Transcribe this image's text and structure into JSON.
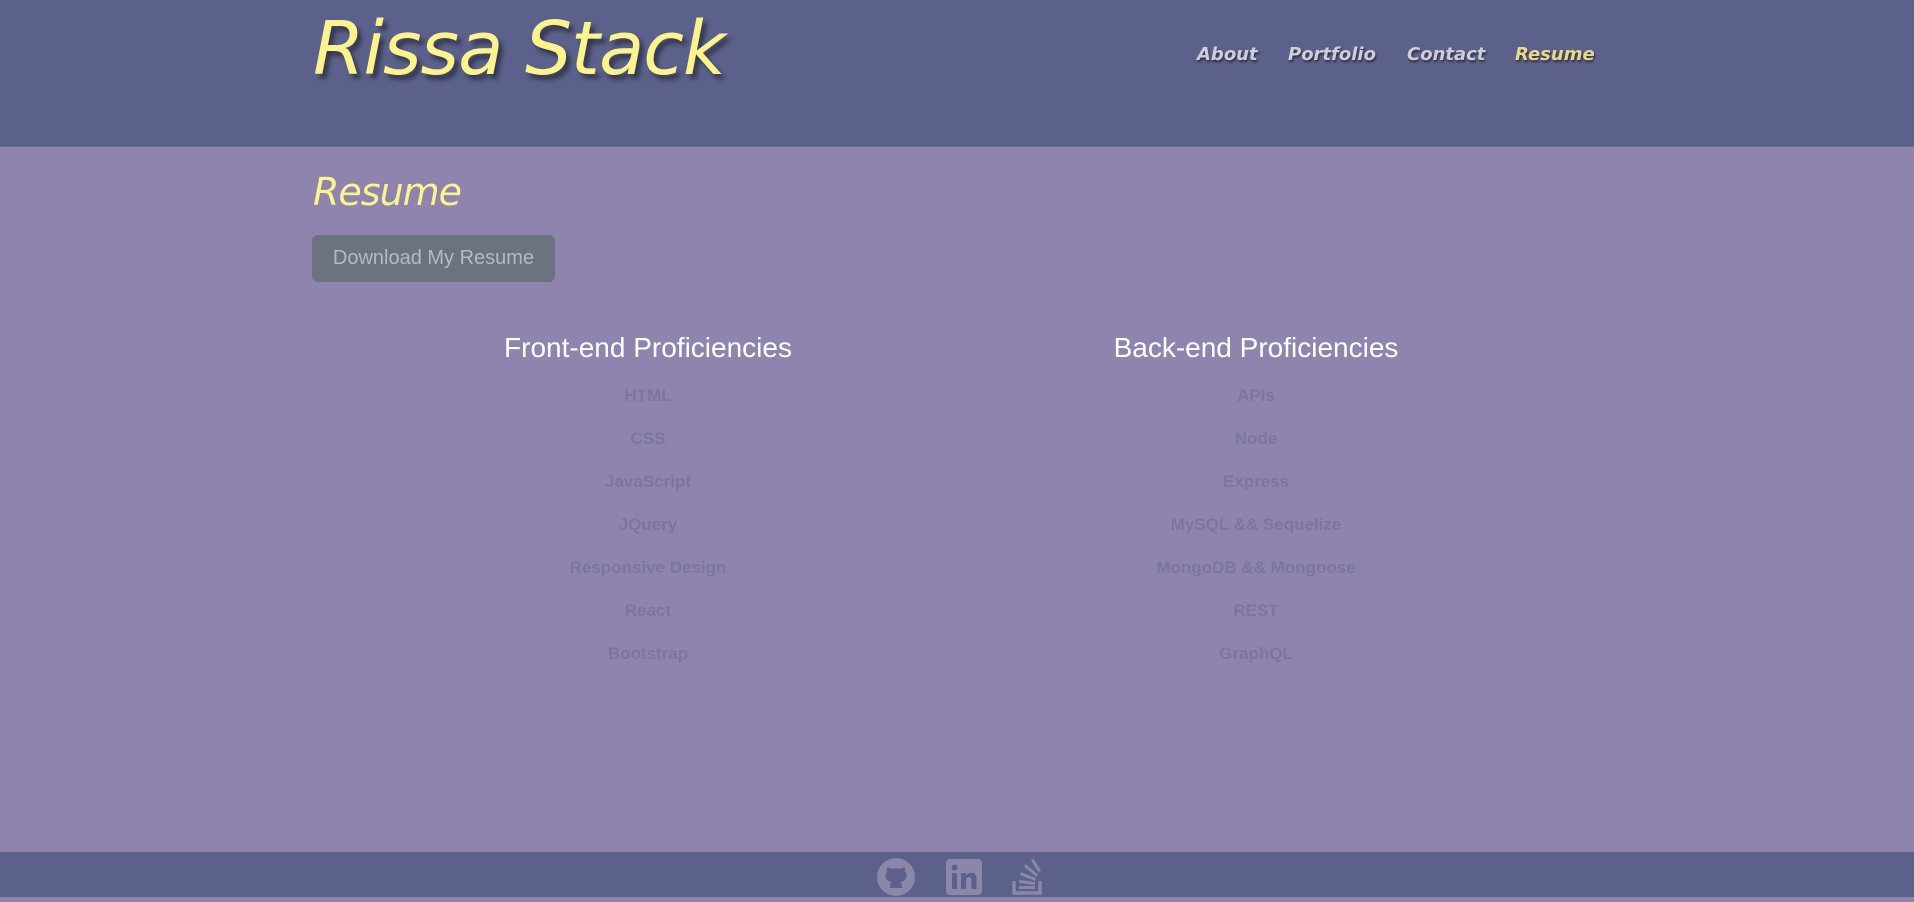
{
  "header": {
    "brand": "Rissa Stack",
    "nav": [
      {
        "label": "About",
        "active": false
      },
      {
        "label": "Portfolio",
        "active": false
      },
      {
        "label": "Contact",
        "active": false
      },
      {
        "label": "Resume",
        "active": true
      }
    ]
  },
  "main": {
    "title": "Resume",
    "download_label": "Download My Resume",
    "frontend": {
      "heading": "Front-end Proficiencies",
      "items": [
        "HTML",
        "CSS",
        "JavaScript",
        "JQuery",
        "Responsive Design",
        "React",
        "Bootstrap"
      ]
    },
    "backend": {
      "heading": "Back-end Proficiencies",
      "items": [
        "APIs",
        "Node",
        "Express",
        "MySQL && Sequelize",
        "MongoDB && Mongoose",
        "REST",
        "GraphQL"
      ]
    }
  },
  "footer": {
    "icons": [
      "github-icon",
      "linkedin-icon",
      "stackoverflow-icon"
    ]
  },
  "colors": {
    "header_bg": "#5c618b",
    "page_bg": "#8e84ae",
    "accent": "#fbf38c"
  }
}
